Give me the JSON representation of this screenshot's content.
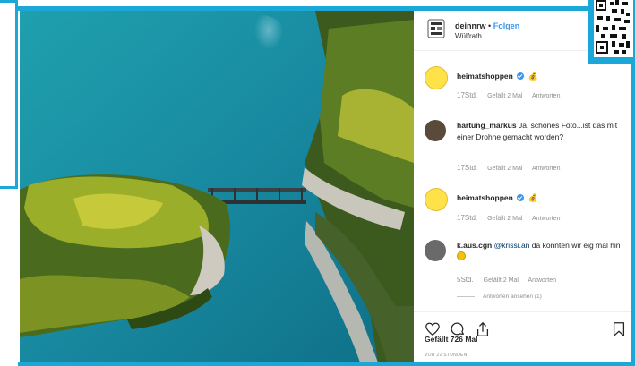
{
  "header": {
    "username": "deinnrw",
    "separator": "•",
    "follow_label": "Folgen",
    "location": "Wülfrath"
  },
  "comments": [
    {
      "username": "heimatshoppen",
      "text": "",
      "time": "17Std.",
      "likes": "Gefällt 2 Mal",
      "reply": "Antworten"
    },
    {
      "username": "hartung_markus",
      "text": "Ja, schönes Foto...ist das mit einer Drohne gemacht worden?",
      "time": "17Std.",
      "likes": "Gefällt 2 Mal",
      "reply": "Antworten"
    },
    {
      "username": "heimatshoppen",
      "text": "",
      "time": "17Std.",
      "likes": "Gefällt 2 Mal",
      "reply": "Antworten"
    },
    {
      "username": "k.aus.cgn",
      "mention": "@krissi.an",
      "text": "da könnten wir eig mal hin",
      "time": "5Std.",
      "likes": "Gefällt 2 Mal",
      "reply": "Antworten"
    }
  ],
  "replies_label": "Antworten ansehen (1)",
  "footer": {
    "likes": "Gefällt 726 Mal",
    "posted": "VOR 22 STUNDEN"
  },
  "colors": {
    "frame": "#1ba8d8",
    "link": "#3897f0",
    "water": "#1b8fa0"
  },
  "icons": [
    "heart-icon",
    "comment-icon",
    "share-icon",
    "bookmark-icon",
    "verified-icon",
    "moneybag-icon",
    "qr-code-icon"
  ]
}
